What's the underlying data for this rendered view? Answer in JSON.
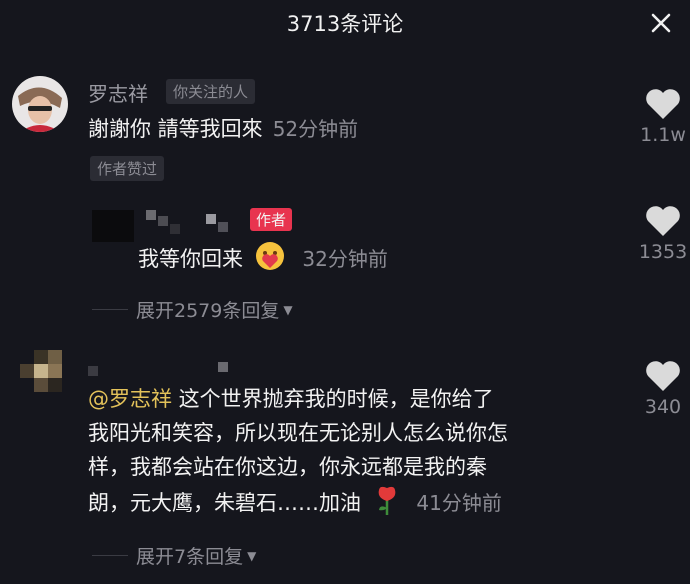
{
  "header": {
    "title": "3713条评论"
  },
  "comments": [
    {
      "name": "罗志祥",
      "follow_tag": "你关注的人",
      "text": "謝謝你 請等我回來",
      "time": "52分钟前",
      "author_liked": "作者赞过",
      "likes": "1.1w",
      "reply": {
        "author_tag": "作者",
        "text": "我等你回来",
        "time": "32分钟前",
        "likes": "1353"
      },
      "expand_label": "展开2579条回复"
    },
    {
      "mention": "@罗志祥",
      "text_line1": " 这个世界抛弃我的时候，是你给了",
      "text_line2": "我阳光和笑容，所以现在无论别人怎么说你怎",
      "text_line3": "样，我都会站在你这边，你永远都是我的秦",
      "text_line4": "朗，元大鹰，朱碧石……加油",
      "time": "41分钟前",
      "likes": "340",
      "expand_label": "展开7条回复"
    }
  ],
  "colors": {
    "author_tag": "#e8344f",
    "mention": "#e3c25a",
    "background": "#15161d"
  },
  "icons": {
    "close": "close-icon",
    "like": "heart-icon",
    "emoji": "heart-face-emoji-icon",
    "rose": "rose-emoji-icon"
  }
}
